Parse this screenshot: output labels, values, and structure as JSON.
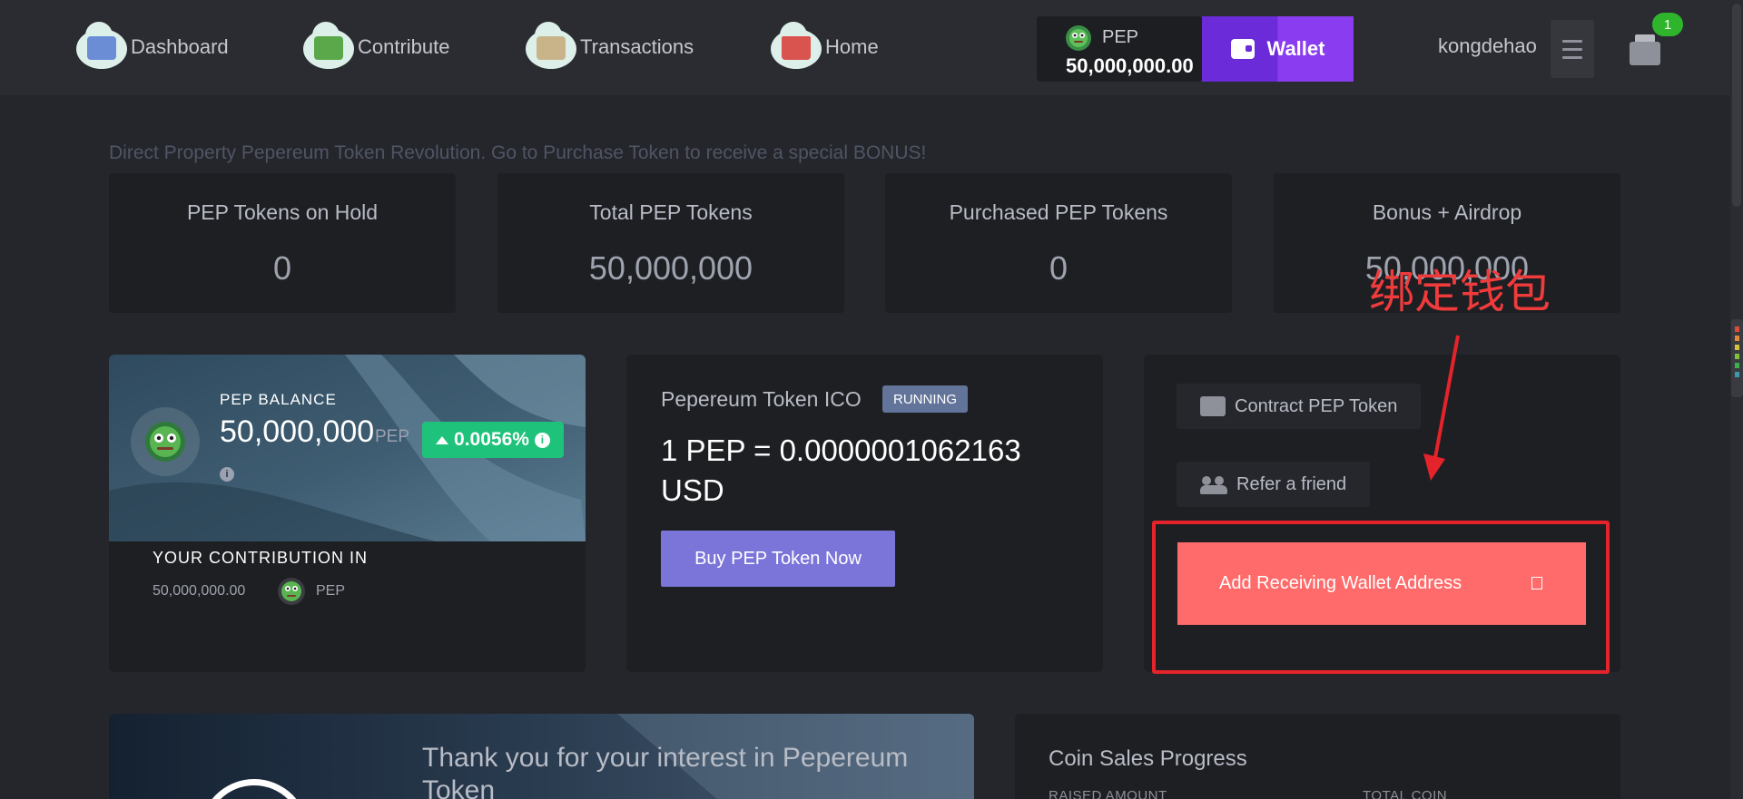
{
  "nav": {
    "items": [
      {
        "label": "Dashboard",
        "icon": "dashboard-icon",
        "color": "#6b8dd6"
      },
      {
        "label": "Contribute",
        "icon": "money-icon",
        "color": "#5aa84a"
      },
      {
        "label": "Transactions",
        "icon": "transactions-icon",
        "color": "#c9b48a"
      },
      {
        "label": "Home",
        "icon": "home-icon",
        "color": "#d9534f"
      }
    ],
    "pep_code": "PEP",
    "pep_amount": "50,000,000.00",
    "wallet_label": "Wallet",
    "username": "kongdehao",
    "mail_badge": "1"
  },
  "announcement": "Direct Property Pepereum Token Revolution. Go to Purchase Token to receive a special BONUS!",
  "stats": [
    {
      "label": "PEP Tokens on Hold",
      "value": "0"
    },
    {
      "label": "Total PEP Tokens",
      "value": "50,000,000"
    },
    {
      "label": "Purchased PEP Tokens",
      "value": "0"
    },
    {
      "label": "Bonus + Airdrop",
      "value": "50,000,000"
    }
  ],
  "annotation": {
    "text": "绑定钱包",
    "color": "#ef3b3b"
  },
  "balance": {
    "label": "PEP BALANCE",
    "amount": "50,000,000",
    "unit": "PEP",
    "change": "0.0056%",
    "info_glyph": "i",
    "contribution_label": "YOUR CONTRIBUTION IN",
    "contribution_amount": "50,000,000.00",
    "contribution_unit": "PEP"
  },
  "ico": {
    "title": "Pepereum Token ICO",
    "status": "RUNNING",
    "rate": "1 PEP = 0.0000001062163 USD",
    "buy_label": "Buy PEP Token Now"
  },
  "actions": {
    "contract_label": "Contract PEP Token",
    "refer_label": "Refer a friend",
    "add_wallet_label": "Add Receiving Wallet Address"
  },
  "bottom": {
    "thanks_title": "Thank you for your interest in Pepereum Token",
    "sales_title": "Coin Sales Progress",
    "sales_col1": "RAISED AMOUNT",
    "sales_col2": "TOTAL COIN"
  },
  "colors": {
    "accent_purple": "#6c2bd9",
    "success_green": "#1fc27a",
    "danger_red": "#ff6b6b",
    "annotation_red": "#e4232a"
  }
}
